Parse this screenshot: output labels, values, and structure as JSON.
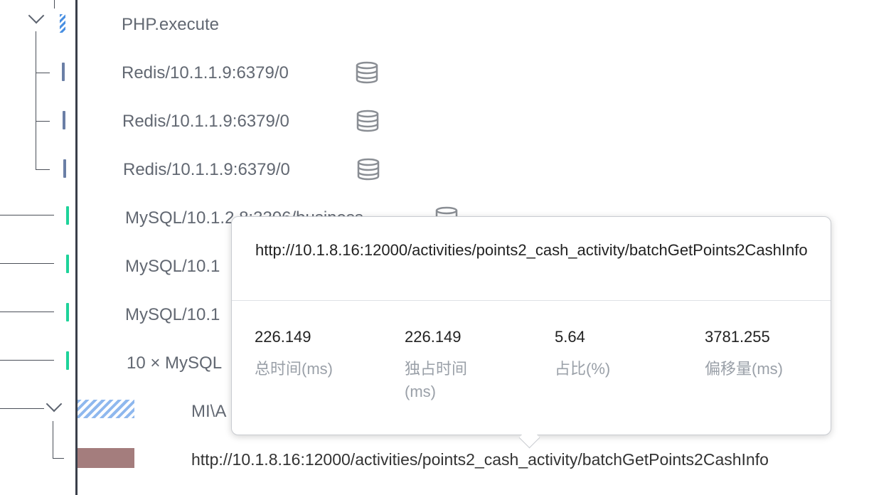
{
  "colors": {
    "redis_bar": "#6b7fa6",
    "mysql_bar": "#1ed39a",
    "php_bar": "#4a90e2",
    "mi_bar": "#8fb8ee",
    "http_bar": "#a47d7d"
  },
  "rows": [
    {
      "label": "PHP.execute",
      "icon": "none"
    },
    {
      "label": "Redis/10.1.1.9:6379/0",
      "icon": "database-icon"
    },
    {
      "label": "Redis/10.1.1.9:6379/0",
      "icon": "database-icon"
    },
    {
      "label": "Redis/10.1.1.9:6379/0",
      "icon": "database-icon"
    },
    {
      "label": "MySQL/10.1.2.8:3306/business",
      "icon": "database-icon"
    },
    {
      "label": "MySQL/10.1",
      "icon": "none"
    },
    {
      "label": "MySQL/10.1",
      "icon": "none"
    },
    {
      "label": "10 × MySQL",
      "icon": "none"
    },
    {
      "label": "MI\\A",
      "icon": "none"
    },
    {
      "label": "http://10.1.8.16:12000/activities/points2_cash_activity/batchGetPoints2CashInfo",
      "icon": "none"
    }
  ],
  "tooltip": {
    "title": "http://10.1.8.16:12000/activities/points2_cash_activity/batchGetPoints2CashInfo",
    "stats": [
      {
        "value": "226.149",
        "label": "总时间(ms)"
      },
      {
        "value": "226.149",
        "label": "独占时间(ms)"
      },
      {
        "value": "5.64",
        "label": "占比(%)"
      },
      {
        "value": "3781.255",
        "label": "偏移量(ms)"
      }
    ]
  }
}
